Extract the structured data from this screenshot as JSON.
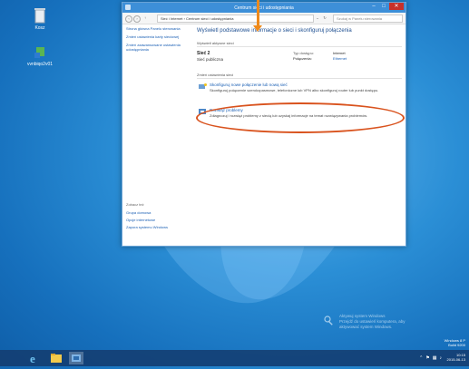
{
  "window": {
    "title": "Centrum sieci i udostępniania",
    "buttons": {
      "minimize": "–",
      "maximize": "□",
      "close": "✕"
    }
  },
  "address": {
    "breadcrumb": "Sieć i Internet  ›  Centrum sieci i udostępniania",
    "search_placeholder": "Szukaj w Panelu sterowania"
  },
  "sidebar": {
    "items": [
      "Strona główna Panelu sterowania",
      "Zmień ustawienia karty sieciowej",
      "Zmień zaawansowane ustawienia udostępniania"
    ],
    "see_also": "Zobacz też",
    "bottom": [
      "Grupa domowa",
      "Opcje internetowe",
      "Zapora systemu Windows"
    ]
  },
  "main": {
    "heading": "Wyświetl podstawowe informacje o sieci i skonfiguruj połączenia",
    "active_section": "Wyświetl aktywne sieci",
    "network": {
      "name": "Sieć 2",
      "type": "Sieć publiczna",
      "access_type_label": "Typ dostępu:",
      "access_type_value": "Internet",
      "connections_label": "Połączenia:",
      "connections_value": "Ethernet"
    },
    "change_section": "Zmień ustawienia sieci",
    "tasks": [
      {
        "title": "Skonfiguruj nowe połączenie lub nową sieć",
        "desc": "Skonfiguruj połączenie szerokopasmowe, telefoniczne lub VPN albo skonfiguruj router lub punkt dostępu."
      },
      {
        "title": "Rozwiąż problemy",
        "desc": "Zdiagnozuj i rozwiąż problemy z siecią lub uzyskaj informacje na temat rozwiązywania problemów."
      }
    ]
  },
  "desktop": {
    "recycle_bin": "Kosz",
    "shortcut": "vvnbiqo2v01"
  },
  "activation": {
    "line1": "Aktywuj system Windows",
    "line2": "Przejdź do ustawień komputera, aby",
    "line3": "aktywować system Windows."
  },
  "watermark": {
    "line1": "Windows 8 P",
    "line2": "Build 9200"
  },
  "tray": {
    "time": "10:15",
    "date": "2015-06-13"
  },
  "colors": {
    "accent": "#3d8fd8",
    "highlight": "#d9531e",
    "pointer": "#ee8a1c"
  }
}
